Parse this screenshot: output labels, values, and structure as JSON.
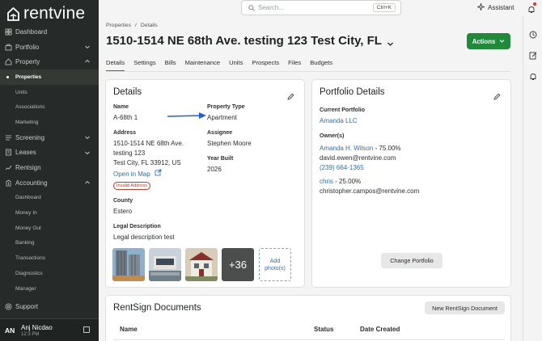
{
  "brand": {
    "name": "rentvine"
  },
  "sidebar": {
    "items": [
      {
        "label": "Dashboard",
        "type": "main",
        "icon": "dashboard-icon"
      },
      {
        "label": "Portfolio",
        "type": "main",
        "icon": "portfolio-icon",
        "chevron": "down"
      },
      {
        "label": "Property",
        "type": "main",
        "icon": "property-icon",
        "chevron": "up"
      },
      {
        "label": "Properties",
        "type": "sub",
        "active": true
      },
      {
        "label": "Units",
        "type": "sub"
      },
      {
        "label": "Associations",
        "type": "sub"
      },
      {
        "label": "Marketing",
        "type": "sub"
      },
      {
        "label": "Screening",
        "type": "main",
        "icon": "screening-icon",
        "chevron": "down"
      },
      {
        "label": "Leases",
        "type": "main",
        "icon": "leases-icon",
        "chevron": "down"
      },
      {
        "label": "Rentsign",
        "type": "main",
        "icon": "rentsign-icon"
      },
      {
        "label": "Accounting",
        "type": "main",
        "icon": "accounting-icon",
        "chevron": "up"
      },
      {
        "label": "Dashboard",
        "type": "sub"
      },
      {
        "label": "Money In",
        "type": "sub"
      },
      {
        "label": "Money Out",
        "type": "sub"
      },
      {
        "label": "Banking",
        "type": "sub"
      },
      {
        "label": "Transactions",
        "type": "sub"
      },
      {
        "label": "Diagnostics",
        "type": "sub"
      },
      {
        "label": "Manager",
        "type": "sub"
      },
      {
        "label": "Support",
        "type": "main",
        "icon": "support-icon",
        "spacer": true
      }
    ],
    "user": {
      "initials": "AN",
      "name": "Anj Nicdao",
      "time": "12:3 PM"
    }
  },
  "topbar": {
    "search_placeholder": "Search...",
    "search_shortcut": "Ctrl+K",
    "assistant_label": "Assistant"
  },
  "breadcrumb": [
    "Properties",
    "/",
    "Details"
  ],
  "page_title": "1510-1514 NE 68th Ave. testing 123 Test City, FL",
  "actions_label": "Actions",
  "tabs": [
    "Details",
    "Settings",
    "Bills",
    "Maintenance",
    "Units",
    "Prospects",
    "Files",
    "Budgets"
  ],
  "details": {
    "heading": "Details",
    "name_label": "Name",
    "name_value": "A-68th 1",
    "property_type_label": "Property Type",
    "property_type_value": "Apartment",
    "address_label": "Address",
    "address_line1": "1510-1514 NE 68th Ave.",
    "address_line2": "testing 123",
    "address_line3": "Test City, FL 33912, US",
    "open_in_map": "Open in Map",
    "invalid_badge": "Invalid Address",
    "assignee_label": "Assignee",
    "assignee_value": "Stephen Moore",
    "year_built_label": "Year Built",
    "year_built_value": "2026",
    "county_label": "County",
    "county_value": "Estero",
    "legal_label": "Legal Description",
    "legal_value": "Legal description test",
    "more_photos": "+36",
    "add_photo_line1": "Add",
    "add_photo_line2": "photo(s)"
  },
  "portfolio": {
    "heading": "Portfolio Details",
    "current_label": "Current Portfolio",
    "current_value": "Amanda LLC",
    "owners_label": "Owner(s)",
    "owner1_name": "Amanda H. Wilson",
    "owner1_pct": "- 75.00%",
    "owner1_email": "david.ewen@rentvine.com",
    "owner1_phone": "(239) 664-1365",
    "owner2_name": "chris",
    "owner2_pct": "- 25.00%",
    "owner2_email": "christopher.campos@rentvine.com",
    "change_button": "Change Portfolio"
  },
  "rentsign": {
    "heading": "RentSign Documents",
    "new_button": "New RentSign Document",
    "columns": [
      "Name",
      "Status",
      "Date Created"
    ]
  },
  "colors": {
    "accent": "#1e8a3a",
    "link": "#2f6fb0",
    "sidebar": "#262a28",
    "error": "#c0392b",
    "annotation_arrow": "#1f5fd6"
  }
}
